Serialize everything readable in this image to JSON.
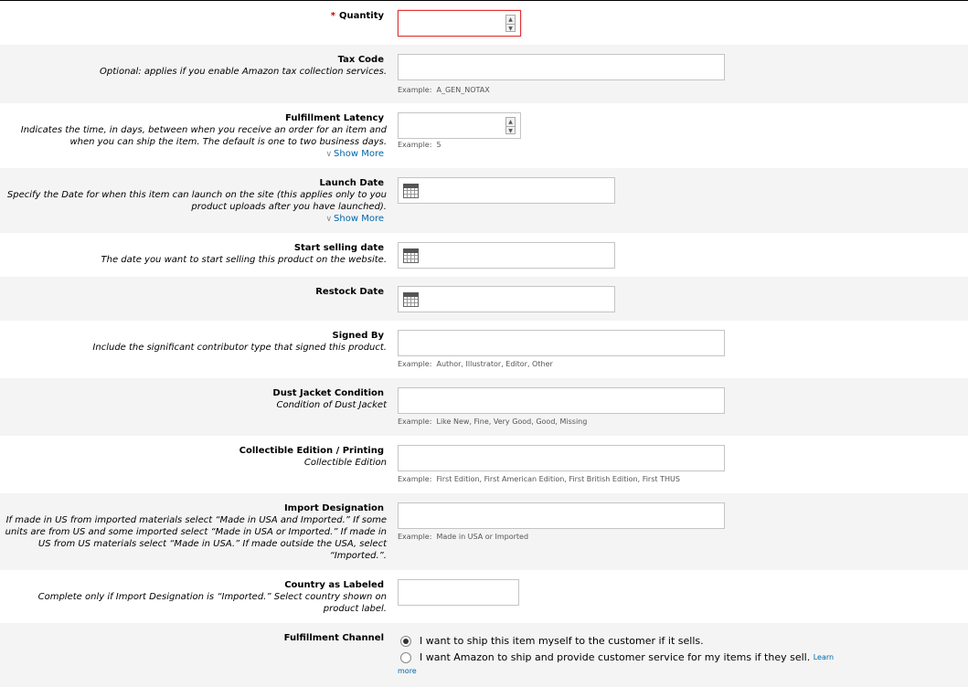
{
  "quantity": {
    "required_marker": "*",
    "title": "Quantity",
    "value": ""
  },
  "tax_code": {
    "title": "Tax Code",
    "desc": "Optional: applies if you enable Amazon tax collection services.",
    "value": "",
    "example_label": "Example:",
    "example": "A_GEN_NOTAX"
  },
  "fulfillment_latency": {
    "title": "Fulfillment Latency",
    "desc": "Indicates the time, in days, between when you receive an order for an item and when you can ship the item.  The default is one to two business days.",
    "show_more": "Show More",
    "value": "",
    "example_label": "Example:",
    "example": "5"
  },
  "launch_date": {
    "title": "Launch Date",
    "desc": "Specify the Date for when this item can launch on the site (this applies only to you product uploads after you have launched).",
    "show_more": "Show More",
    "value": ""
  },
  "start_selling_date": {
    "title": "Start selling date",
    "desc": "The date you want to start selling this product on the website.",
    "value": ""
  },
  "restock_date": {
    "title": "Restock Date",
    "value": ""
  },
  "signed_by": {
    "title": "Signed By",
    "desc": "Include the significant contributor type that signed this product.",
    "value": "",
    "example_label": "Example:",
    "example": "Author, Illustrator, Editor, Other"
  },
  "dust_jacket": {
    "title": "Dust Jacket Condition",
    "desc": "Condition of Dust Jacket",
    "value": "",
    "example_label": "Example:",
    "example": "Like New, Fine, Very Good, Good, Missing"
  },
  "collectible_edition": {
    "title": "Collectible Edition / Printing",
    "desc": "Collectible Edition",
    "value": "",
    "example_label": "Example:",
    "example": "First Edition, First American Edition, First British Edition, First THUS"
  },
  "import_designation": {
    "title": "Import Designation",
    "desc": "If made in US from imported materials select “Made in USA and Imported.” If some units are from US and some imported select “Made in USA or Imported.” If made in US from US materials select “Made in USA.” If made outside the USA, select “Imported.”.",
    "value": "",
    "example_label": "Example:",
    "example": "Made in USA or Imported"
  },
  "country_labeled": {
    "title": "Country as Labeled",
    "desc": "Complete only if Import Designation is “Imported.” Select country shown on product label.",
    "value": ""
  },
  "fulfillment_channel": {
    "title": "Fulfillment Channel",
    "option_merchant": "I want to ship this item myself to the customer if it sells.",
    "option_amazon": "I want Amazon to ship and provide customer service for my items if they sell.",
    "learn_more_a": "Learn",
    "learn_more_b": "more"
  }
}
